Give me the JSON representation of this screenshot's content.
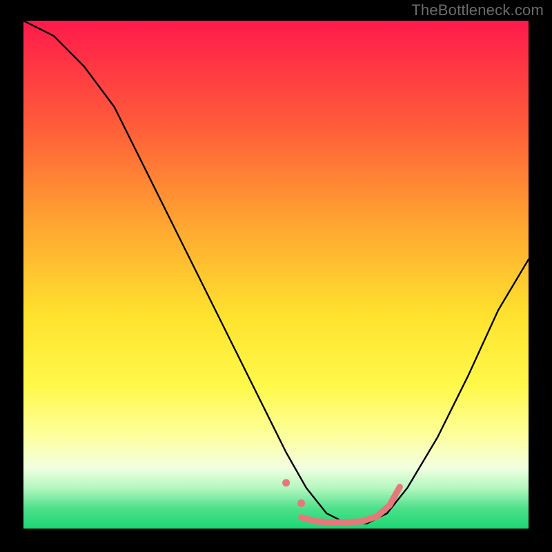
{
  "watermark": "TheBottleneck.com",
  "chart_data": {
    "type": "line",
    "title": "",
    "xlabel": "",
    "ylabel": "",
    "xlim": [
      0,
      100
    ],
    "ylim": [
      0,
      100
    ],
    "grid": false,
    "gradient_stops": [
      {
        "offset": 0.0,
        "color": "#ff1a4b"
      },
      {
        "offset": 0.2,
        "color": "#ff5a3a"
      },
      {
        "offset": 0.4,
        "color": "#ffa531"
      },
      {
        "offset": 0.58,
        "color": "#ffe22e"
      },
      {
        "offset": 0.72,
        "color": "#fff94a"
      },
      {
        "offset": 0.82,
        "color": "#fdffa0"
      },
      {
        "offset": 0.88,
        "color": "#f2ffe0"
      },
      {
        "offset": 0.92,
        "color": "#b4f7c0"
      },
      {
        "offset": 0.96,
        "color": "#4ee08a"
      },
      {
        "offset": 1.0,
        "color": "#1bd874"
      }
    ],
    "series": [
      {
        "name": "curve",
        "stroke": "#000000",
        "stroke_width": 2.4,
        "x": [
          0,
          6,
          12,
          18,
          24,
          30,
          36,
          42,
          48,
          52,
          56,
          60,
          64,
          68,
          72,
          76,
          82,
          88,
          94,
          100
        ],
        "y": [
          100,
          97,
          91,
          83,
          71,
          59,
          47,
          35,
          23,
          15,
          8,
          3,
          1,
          1,
          3,
          8,
          18,
          30,
          43,
          53
        ]
      }
    ],
    "highlight": {
      "name": "highlight-band",
      "stroke": "#e6777a",
      "stroke_width": 9,
      "dot_radius": 5.5,
      "dots": [
        {
          "x": 52,
          "y": 9
        },
        {
          "x": 55,
          "y": 5
        }
      ],
      "path": {
        "x": [
          55,
          58,
          62,
          67,
          70,
          72.5,
          74.5
        ],
        "y": [
          2.2,
          1.4,
          1.2,
          1.4,
          2.4,
          4.6,
          8.2
        ]
      }
    }
  }
}
